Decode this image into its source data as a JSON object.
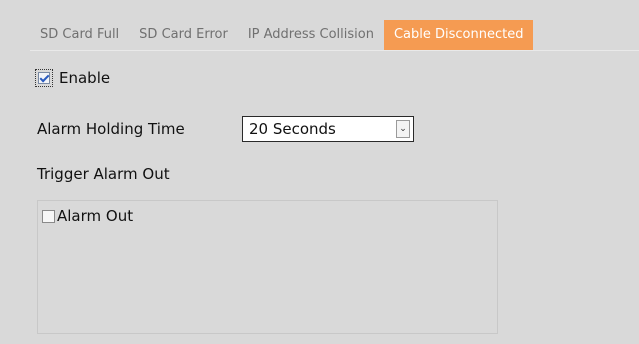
{
  "tabs": [
    {
      "label": "SD Card Full",
      "active": false
    },
    {
      "label": "SD Card Error",
      "active": false
    },
    {
      "label": "IP Address Collision",
      "active": false
    },
    {
      "label": "Cable Disconnected",
      "active": true
    }
  ],
  "enable": {
    "label": "Enable",
    "checked": true
  },
  "alarm_holding_time": {
    "label": "Alarm Holding Time",
    "value": "20 Seconds",
    "dropdown_icon": "chevron-down-icon"
  },
  "trigger_alarm_out": {
    "label": "Trigger Alarm Out",
    "items": [
      {
        "label": "Alarm Out",
        "checked": false
      }
    ]
  },
  "colors": {
    "active_tab": "#f59b52",
    "background": "#d9d9d9"
  }
}
